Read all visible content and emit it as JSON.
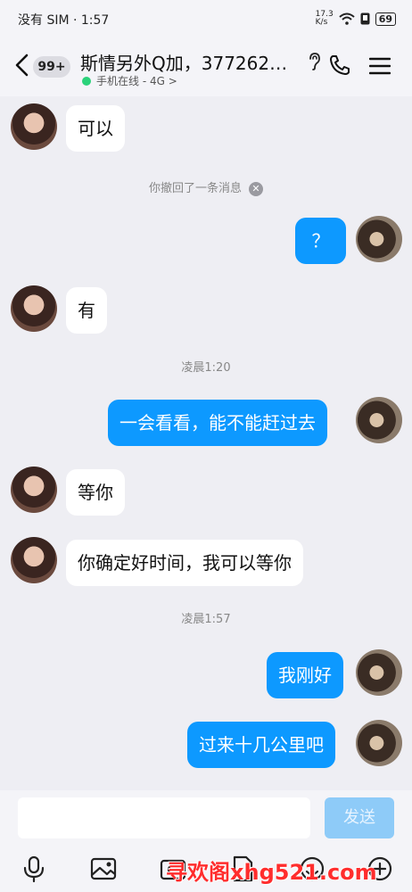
{
  "status": {
    "left": "没有 SIM · 1:57",
    "net": "17.3\nK/s",
    "battery": "69"
  },
  "header": {
    "unread_badge": "99+",
    "title": "斯情另外Q加，377262…",
    "online_status": "手机在线 - 4G >"
  },
  "messages": [
    {
      "side": "in",
      "text": "可以"
    },
    {
      "type": "system",
      "text": "你撤回了一条消息"
    },
    {
      "side": "out",
      "text": "？"
    },
    {
      "side": "in",
      "text": "有"
    },
    {
      "type": "time",
      "text": "凌晨1:20"
    },
    {
      "side": "out",
      "text": "一会看看，能不能赶过去"
    },
    {
      "side": "in",
      "text": "等你"
    },
    {
      "side": "in",
      "text": "你确定好时间，我可以等你"
    },
    {
      "type": "time",
      "text": "凌晨1:57"
    },
    {
      "side": "out",
      "text": "我刚好"
    },
    {
      "side": "out",
      "text": "过来十几公里吧"
    }
  ],
  "input": {
    "value": "",
    "send_label": "发送"
  },
  "toolbar": [
    "microphone-icon",
    "image-icon",
    "camera-icon",
    "file-icon",
    "emoji-icon",
    "plus-icon"
  ],
  "watermark": "寻欢阁xhg521.com",
  "colors": {
    "outgoing_bubble": "#0d99ff",
    "send_disabled": "#8ecbf8",
    "online_dot": "#2bd27a"
  }
}
